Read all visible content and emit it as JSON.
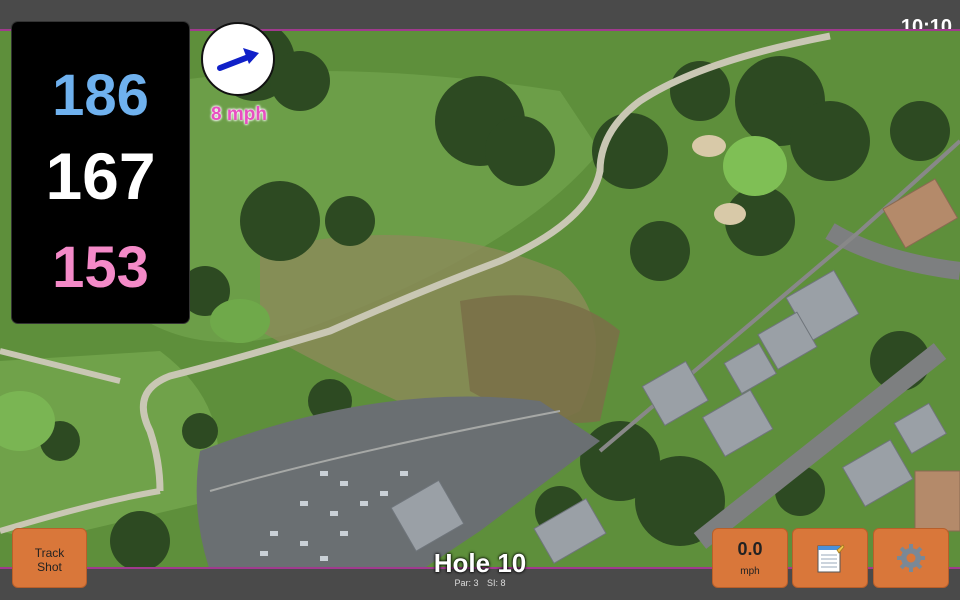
{
  "status": {
    "time": "10:10"
  },
  "distances": {
    "back": "186",
    "middle": "167",
    "front": "153"
  },
  "wind": {
    "speed_label": "8 mph",
    "icon": "wind-direction-arrow-icon"
  },
  "buttons": {
    "track_shot": "Track Shot",
    "speed_value": "0.0",
    "speed_unit": "mph",
    "notes_icon": "notepad-icon",
    "settings_icon": "gear-icon"
  },
  "hole": {
    "title": "Hole 10",
    "par_label": "Par: 3",
    "si_label": "SI: 8"
  },
  "colors": {
    "back": "#6fb1ee",
    "middle": "#ffffff",
    "front": "#f48ac8",
    "button": "#d9773a",
    "wind_text": "#e84fc1"
  }
}
